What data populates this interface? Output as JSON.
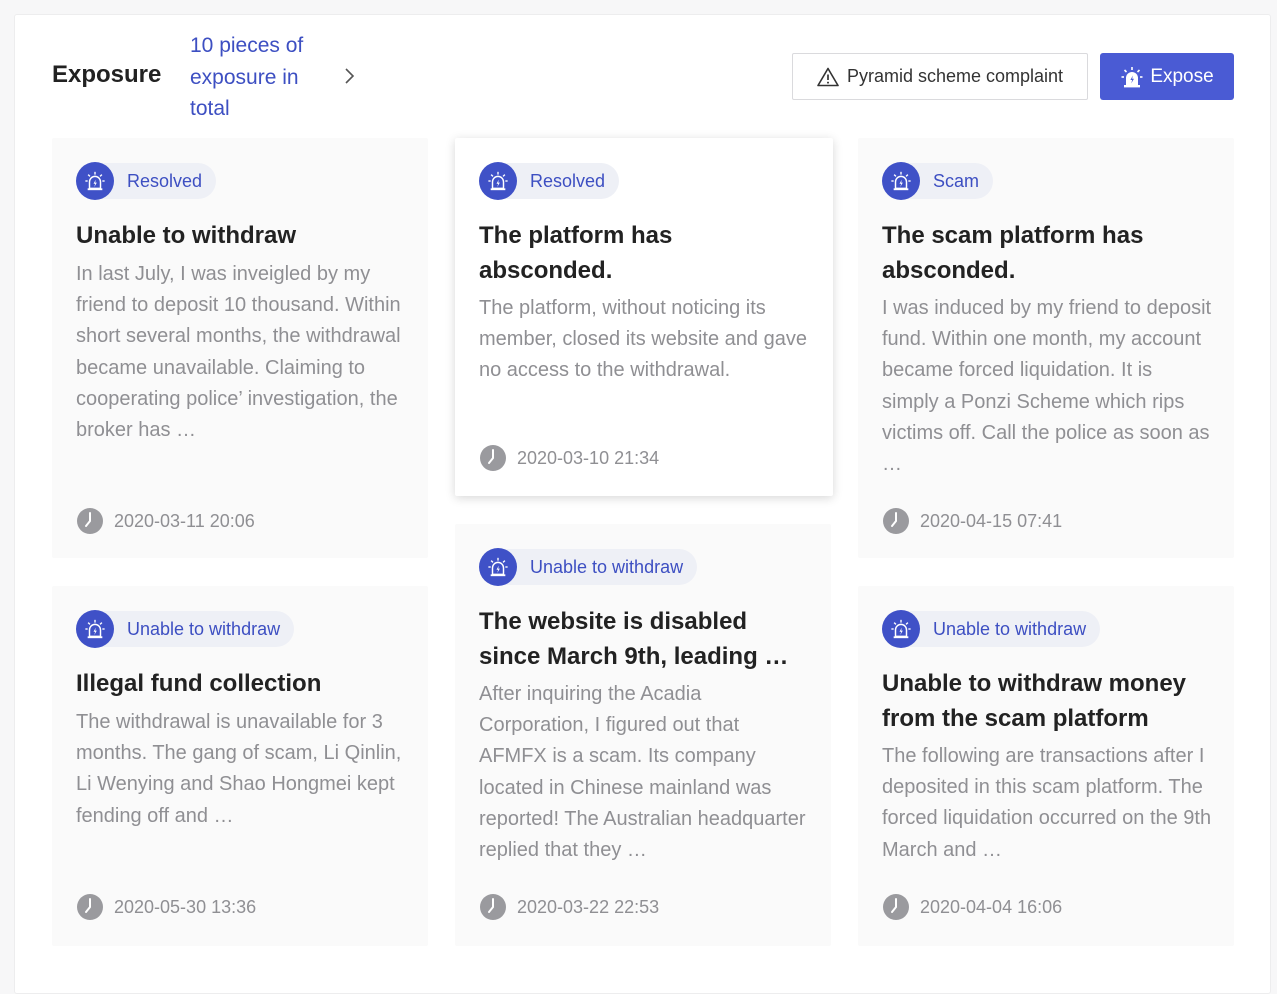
{
  "header": {
    "title": "Exposure",
    "count_text": "10 pieces of exposure in total",
    "complaint_button": "Pyramid scheme complaint",
    "expose_button": "Expose"
  },
  "colors": {
    "accent": "#4a5bd4",
    "tag_bg": "#eef0f6",
    "muted_text": "#8f8f93"
  },
  "cards": [
    {
      "tag": "Resolved",
      "title": "Unable to withdraw",
      "body": "In last July, I was inveigled by my friend to deposit 10 thousand. Within short several months, the withdrawal became unavailable. Claiming to cooperating police’ investigation, the broker has …",
      "time": "2020-03-11 20:06"
    },
    {
      "tag": "Resolved",
      "title": "The platform has absconded.",
      "body": "The platform, without noticing its member, closed its website and gave no access to the withdrawal.",
      "time": "2020-03-10 21:34"
    },
    {
      "tag": "Scam",
      "title": "The scam platform has absconded.",
      "body": "I was induced by my friend to deposit fund. Within one month, my account became forced liquidation. It is simply a Ponzi Scheme which rips victims off. Call the police as soon as …",
      "time": "2020-04-15 07:41"
    },
    {
      "tag": "Unable to withdraw",
      "title": "Illegal fund collection",
      "body": "The withdrawal is unavailable for 3 months. The gang of scam, Li Qinlin, Li Wenying and Shao Hongmei kept fending off and …",
      "time": "2020-05-30 13:36"
    },
    {
      "tag": "Unable to withdraw",
      "title": "The website is disabled since March 9th, leading …",
      "body": "After inquiring the Acadia Corporation, I figured out that AFMFX is a scam. Its company located in Chinese mainland was reported! The Australian headquarter replied that they …",
      "time": "2020-03-22 22:53"
    },
    {
      "tag": "Unable to withdraw",
      "title": "Unable to withdraw money from the scam platform",
      "body": "The following are transactions after I deposited in this scam platform. The forced liquidation occurred on the 9th March and …",
      "time": "2020-04-04 16:06"
    }
  ]
}
